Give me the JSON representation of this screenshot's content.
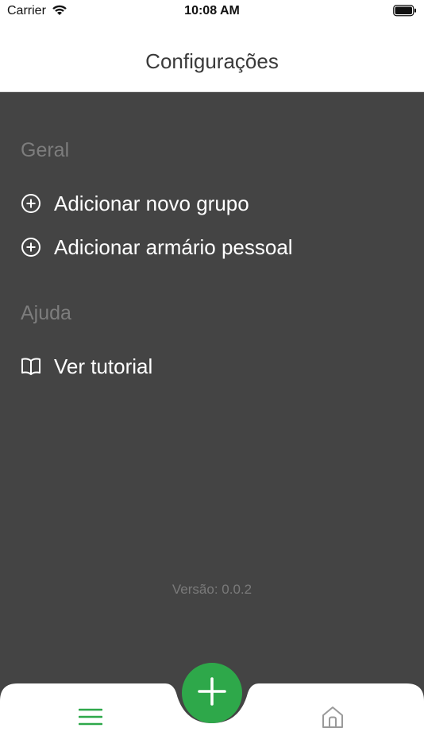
{
  "status_bar": {
    "carrier": "Carrier",
    "time": "10:08 AM"
  },
  "nav": {
    "title": "Configurações"
  },
  "sections": [
    {
      "header": "Geral",
      "items": [
        {
          "label": "Adicionar novo grupo",
          "icon": "plus-circle-icon"
        },
        {
          "label": "Adicionar armário pessoal",
          "icon": "plus-circle-icon"
        }
      ]
    },
    {
      "header": "Ajuda",
      "items": [
        {
          "label": "Ver tutorial",
          "icon": "book-icon"
        }
      ]
    }
  ],
  "footer": {
    "version": "Versão: 0.0.2"
  },
  "tab_bar": {
    "items": [
      {
        "name": "menu",
        "icon": "hamburger-menu-icon",
        "active": true
      },
      {
        "name": "add",
        "icon": "plus-icon"
      },
      {
        "name": "home",
        "icon": "home-icon",
        "active": false
      }
    ]
  },
  "colors": {
    "accent_green": "#2ea84a",
    "background_dark": "#444444",
    "section_header_gray": "#7d7d7d",
    "inactive_icon_gray": "#9a9a9a"
  }
}
